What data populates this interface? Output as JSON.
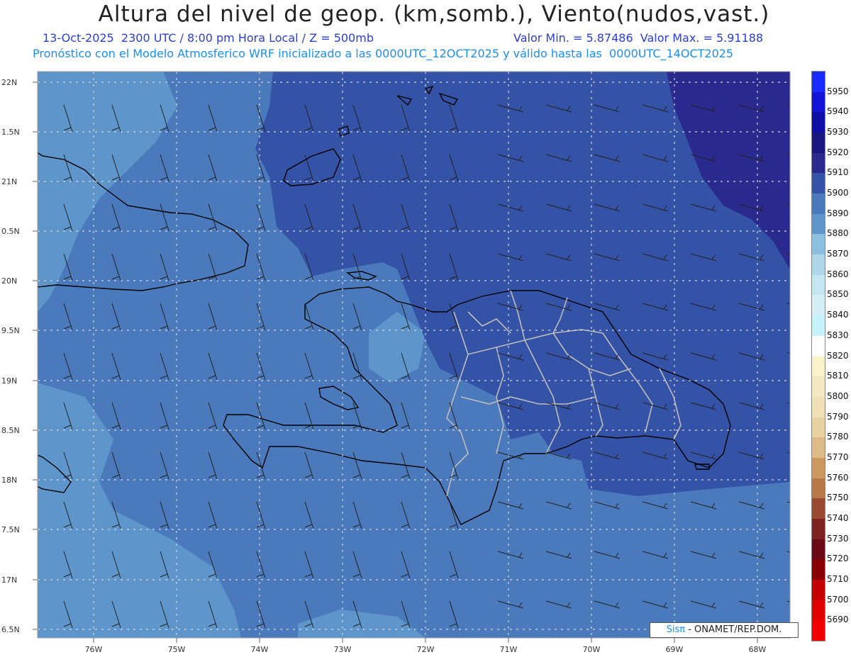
{
  "title": "Altura del nivel de geop. (km,somb.), Viento(nudos,vast.)",
  "subtitle_left": "13-Oct-2025  2300 UTC / 8:00 pm Hora Local / Z = 500mb",
  "subtitle_right": "Valor Min. = 5.87486  Valor Max. = 5.91188",
  "subtitle_2": "Pronóstico con el Modelo Atmosferico WRF inicializado a las 0000UTC_12OCT2025 y válido hasta las  0000UTC_14OCT2025",
  "credit": {
    "brand": "Sisπ",
    "text": " - ONAMET/REP.DOM."
  },
  "lat_labels": [
    "22N",
    "1.5N",
    "21N",
    "0.5N",
    "20N",
    "9.5N",
    "19N",
    "8.5N",
    "18N",
    "7.5N",
    "17N",
    "6.5N"
  ],
  "lon_labels": [
    "76W",
    "75W",
    "74W",
    "73W",
    "72W",
    "71W",
    "70W",
    "69W",
    "68W"
  ],
  "colorbar": [
    {
      "label": "5950",
      "color": "#1a2aff"
    },
    {
      "label": "5940",
      "color": "#1414d8"
    },
    {
      "label": "5930",
      "color": "#0f0fa8"
    },
    {
      "label": "5920",
      "color": "#181880"
    },
    {
      "label": "5910",
      "color": "#2a2a8e"
    },
    {
      "label": "5900",
      "color": "#3452a6"
    },
    {
      "label": "5890",
      "color": "#4a7abc"
    },
    {
      "label": "5880",
      "color": "#5e96cc"
    },
    {
      "label": "5870",
      "color": "#8cbfe0"
    },
    {
      "label": "5860",
      "color": "#aed8ea"
    },
    {
      "label": "5850",
      "color": "#c4e6f0"
    },
    {
      "label": "5840",
      "color": "#d6eef6"
    },
    {
      "label": "5830",
      "color": "#c6f2fa"
    },
    {
      "label": "5820",
      "color": "#ffffff"
    },
    {
      "label": "5810",
      "color": "#faf2c8"
    },
    {
      "label": "5800",
      "color": "#f4e8c2"
    },
    {
      "label": "5790",
      "color": "#efe0b8"
    },
    {
      "label": "5780",
      "color": "#e8d2a2"
    },
    {
      "label": "5770",
      "color": "#deba86"
    },
    {
      "label": "5760",
      "color": "#cc9860"
    },
    {
      "label": "5750",
      "color": "#b87848"
    },
    {
      "label": "5740",
      "color": "#9a4a30"
    },
    {
      "label": "5730",
      "color": "#7e2222"
    },
    {
      "label": "5720",
      "color": "#6a0a16"
    },
    {
      "label": "5710",
      "color": "#8a0000"
    },
    {
      "label": "5700",
      "color": "#c40000"
    },
    {
      "label": "5690",
      "color": "#e00000"
    },
    {
      "label": "",
      "color": "#f20000"
    }
  ],
  "field_colors": {
    "low": "#5e96cc",
    "mid": "#4a7abc",
    "high": "#3452a6",
    "top": "#2a2a8e"
  }
}
